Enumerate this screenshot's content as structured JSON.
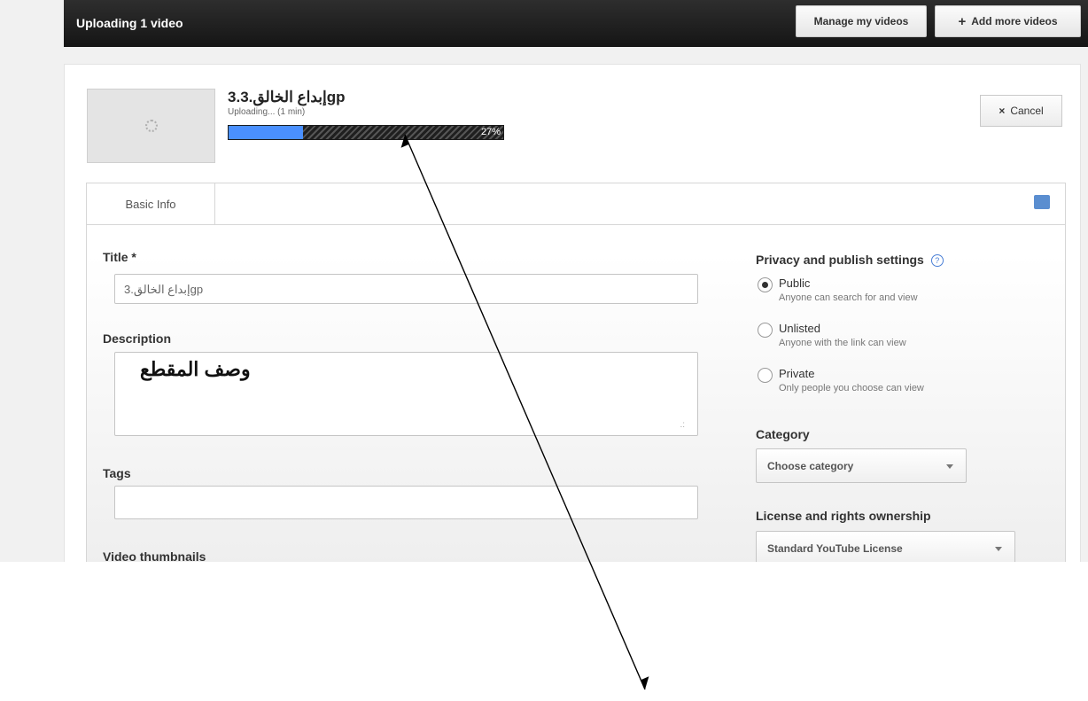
{
  "topbar": {
    "title": "Uploading 1 video",
    "manage_label": "Manage my videos",
    "add_label": "Add more videos"
  },
  "upload": {
    "filename": "3.إبداع الخالق.3gp",
    "status": "Uploading... (1 min)",
    "progress_percent": 27,
    "progress_text": "27%",
    "cancel_label": "Cancel"
  },
  "tabs": [
    {
      "label": "Basic Info"
    }
  ],
  "form": {
    "title_label": "Title *",
    "title_value": "إبداع الخالق.3gp",
    "description_label": "Description",
    "description_value": "وصف المقطع",
    "tags_label": "Tags",
    "tags_value": "",
    "thumbnails_label": "Video thumbnails"
  },
  "privacy": {
    "heading": "Privacy and publish settings",
    "options": [
      {
        "label": "Public",
        "sub": "Anyone can search for and view",
        "checked": true
      },
      {
        "label": "Unlisted",
        "sub": "Anyone with the link can view",
        "checked": false
      },
      {
        "label": "Private",
        "sub": "Only people you choose can view",
        "checked": false
      }
    ]
  },
  "category": {
    "heading": "Category",
    "selected": "Choose category"
  },
  "license": {
    "heading": "License and rights ownership",
    "selected": "Standard YouTube License"
  },
  "colors": {
    "progress_fill": "#4a90ff",
    "topbar": "#1a1a1a",
    "help_icon": "#4a7fd6"
  },
  "icons": {
    "plus": "+",
    "close": "×",
    "help": "?"
  }
}
